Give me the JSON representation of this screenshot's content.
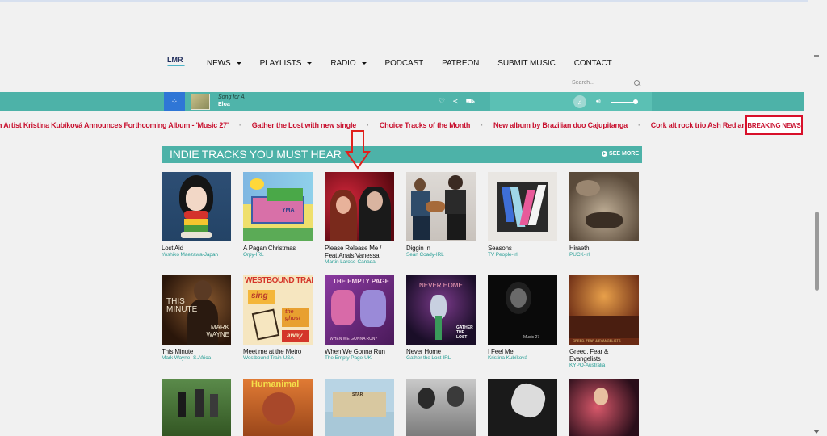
{
  "nav": {
    "logo_text": "LMR",
    "items": [
      {
        "label": "NEWS",
        "dropdown": true
      },
      {
        "label": "PLAYLISTS",
        "dropdown": true
      },
      {
        "label": "RADIO",
        "dropdown": true
      },
      {
        "label": "PODCAST",
        "dropdown": false
      },
      {
        "label": "PATREON",
        "dropdown": false
      },
      {
        "label": "SUBMIT MUSIC",
        "dropdown": false
      },
      {
        "label": "CONTACT",
        "dropdown": false
      }
    ]
  },
  "search": {
    "placeholder": "Search..."
  },
  "player": {
    "song_title": "Song for A",
    "song_artist": "Eloa",
    "accent": "#4db2a8",
    "play_accent": "#2f76d6"
  },
  "ticker": {
    "items": [
      "h Artist Kristina Kubíková Announces Forthcoming Album - 'Music 27'",
      "Gather the Lost with new single",
      "Choice Tracks of the Month",
      "New album by Brazilian duo Cajupitanga",
      "Cork alt rock trio Ash Red are rele"
    ],
    "separator": "·",
    "breaking_label": "BREAKING NEWS"
  },
  "section": {
    "title": "INDIE TRACKS YOU MUST HEAR",
    "see_more": "SEE MORE"
  },
  "tracks": [
    {
      "title": "Lost Aid",
      "artist": "Yoshiko Maezawa-Japan"
    },
    {
      "title": "A Pagan Christmas",
      "artist": "Orpy-IRL"
    },
    {
      "title": "Please Release Me / Feat.Anais Vanessa",
      "artist": "Martin Larose-Canada"
    },
    {
      "title": "Diggin In",
      "artist": "Seán Coady-IRL"
    },
    {
      "title": "Seasons",
      "artist": "TV People-Irl"
    },
    {
      "title": "Hiraeth",
      "artist": "PUCK-Irl"
    },
    {
      "title": "This Minute",
      "artist": "Mark Wayne- S.Africa"
    },
    {
      "title": "Meet me at the Metro",
      "artist": "Westbound Train-USA"
    },
    {
      "title": "When We Gonna Run",
      "artist": "The Empty Page-UK"
    },
    {
      "title": "Never Home",
      "artist": "Gather the Lost-IRL"
    },
    {
      "title": "I Feel Me",
      "artist": "Kristina Kubíková"
    },
    {
      "title": "Greed, Fear & Evangelists",
      "artist": "KYPO-Australia"
    },
    {
      "title": "",
      "artist": ""
    },
    {
      "title": "",
      "artist": ""
    },
    {
      "title": "",
      "artist": ""
    },
    {
      "title": "",
      "artist": ""
    },
    {
      "title": "",
      "artist": ""
    },
    {
      "title": "",
      "artist": ""
    }
  ],
  "art_text": {
    "this_minute": "THIS MINUTE",
    "mark_wayne": "MARK WAYNE",
    "westbound": "WESTBOUND TRAIN",
    "sing": "sing",
    "the_ghost": "the ghost",
    "away": "away",
    "empty_page": "THE EMPTY PAGE",
    "when_run": "WHEN WE GONNA RUN?",
    "never_home": "NEVER HOME",
    "gather_lost": "GATHER THE LOST",
    "music27": "Music 27",
    "greed": "GREED, FEAR & EVANGELISTS",
    "humanimal": "Humanimal",
    "star": "STAR",
    "pagan_sign": "YMA"
  }
}
